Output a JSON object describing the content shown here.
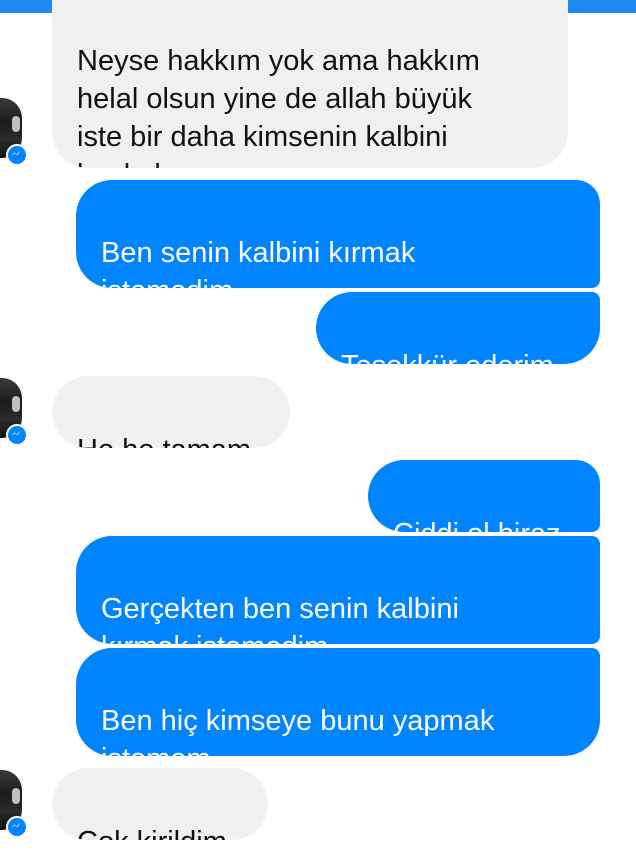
{
  "theme": {
    "incoming_bg": "#f0f0f0",
    "outgoing_bg": "#0084ff",
    "top_bar": "#1e88f4"
  },
  "messages": [
    {
      "direction": "incoming",
      "text": "Neyse hakkım yok ama hakkım\nhelal olsun yine de allah büyük\niste bir daha kimsenin kalbini\nboyle kırmazsın umarım."
    },
    {
      "direction": "outgoing",
      "text": "Ben senin kalbini kırmak\nistemedim"
    },
    {
      "direction": "outgoing",
      "text": "Teşekkür ederim"
    },
    {
      "direction": "incoming",
      "text": "He he tamam"
    },
    {
      "direction": "outgoing",
      "text": "Ciddi ol biraz"
    },
    {
      "direction": "outgoing",
      "text": "Gerçekten ben senin kalbini\nkırmak istemedim"
    },
    {
      "direction": "outgoing",
      "text": "Ben hiç kimseye bunu yapmak\nistemem"
    },
    {
      "direction": "incoming",
      "text": "Çok kirildim"
    }
  ],
  "avatars": [
    {
      "icon": "messenger-badge-icon"
    },
    {
      "icon": "messenger-badge-icon"
    },
    {
      "icon": "messenger-badge-icon"
    }
  ]
}
